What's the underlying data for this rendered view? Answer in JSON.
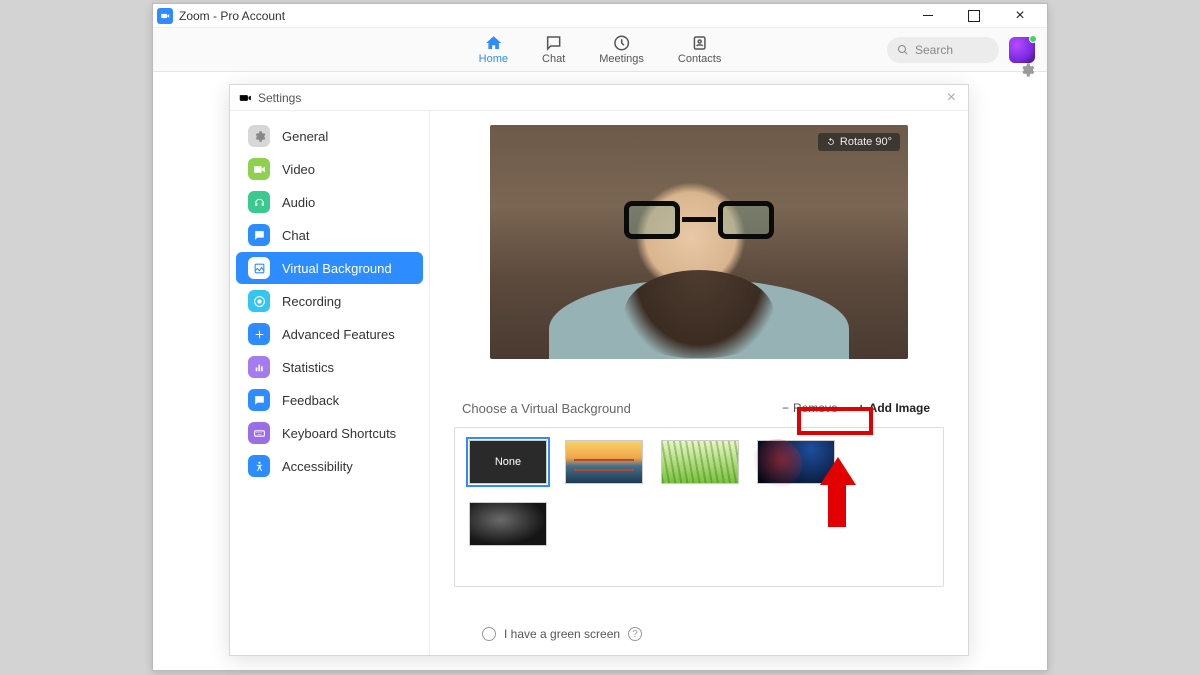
{
  "window": {
    "title": "Zoom - Pro Account"
  },
  "nav": {
    "items": [
      {
        "label": "Home"
      },
      {
        "label": "Chat"
      },
      {
        "label": "Meetings"
      },
      {
        "label": "Contacts"
      }
    ],
    "active_index": 0,
    "search_placeholder": "Search"
  },
  "settings": {
    "title": "Settings",
    "sidebar": {
      "items": [
        {
          "label": "General"
        },
        {
          "label": "Video"
        },
        {
          "label": "Audio"
        },
        {
          "label": "Chat"
        },
        {
          "label": "Virtual Background"
        },
        {
          "label": "Recording"
        },
        {
          "label": "Advanced Features"
        },
        {
          "label": "Statistics"
        },
        {
          "label": "Feedback"
        },
        {
          "label": "Keyboard Shortcuts"
        },
        {
          "label": "Accessibility"
        }
      ],
      "active_index": 4
    },
    "pane": {
      "rotate_label": "Rotate 90°",
      "choose_label": "Choose a Virtual Background",
      "remove_label": "Remove",
      "add_image_label": "Add Image",
      "backgrounds": {
        "none_label": "None",
        "selected_index": 0,
        "count": 5
      },
      "green_screen_label": "I have a green screen"
    }
  },
  "annotation": {
    "highlight_target": "add-image-button",
    "highlight_color": "#e30000"
  }
}
